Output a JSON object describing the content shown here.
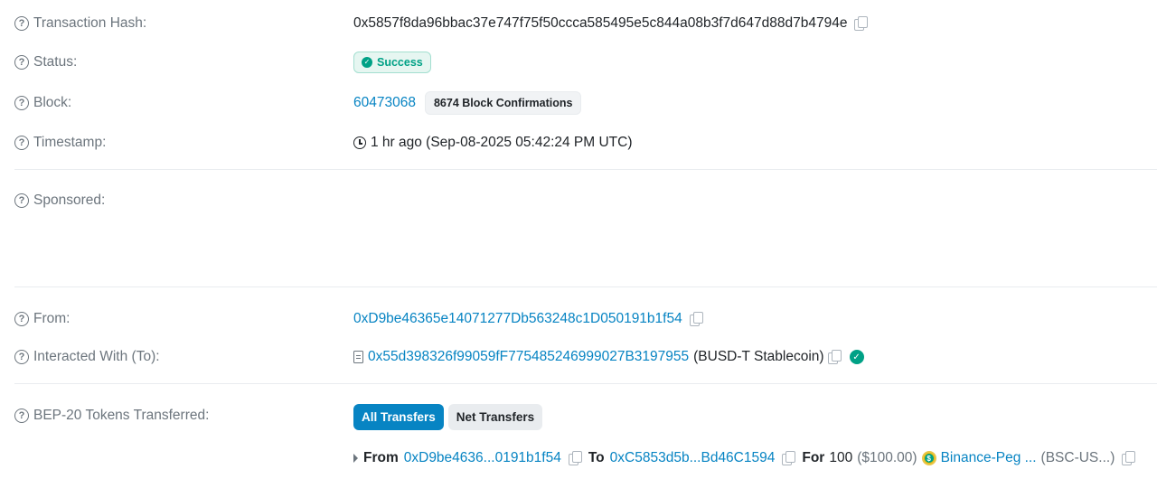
{
  "tx_hash": {
    "label": "Transaction Hash:",
    "value": "0x5857f8da96bbac37e747f75f50ccca585495e5c844a08b3f7d647d88d7b4794e"
  },
  "status": {
    "label": "Status:",
    "value": "Success"
  },
  "block": {
    "label": "Block:",
    "number": "60473068",
    "confirmations": "8674 Block Confirmations"
  },
  "timestamp": {
    "label": "Timestamp:",
    "value": "1 hr ago (Sep-08-2025 05:42:24 PM UTC)"
  },
  "sponsored": {
    "label": "Sponsored:"
  },
  "from": {
    "label": "From:",
    "address": "0xD9be46365e14071277Db563248c1D050191b1f54"
  },
  "interacted": {
    "label": "Interacted With (To):",
    "address": "0x55d398326f99059fF775485246999027B3197955",
    "name": "(BUSD-T Stablecoin)"
  },
  "tokens": {
    "label": "BEP-20 Tokens Transferred:",
    "tabs": [
      "All Transfers",
      "Net Transfers"
    ],
    "transfer": {
      "from_label": "From",
      "from_address": "0xD9be4636...0191b1f54",
      "to_label": "To",
      "to_address": "0xC5853d5b...Bd46C1594",
      "for_label": "For",
      "amount": "100",
      "usd": "($100.00)",
      "token_name": "Binance-Peg ...",
      "token_symbol": "(BSC-US...)"
    }
  },
  "colors": {
    "link": "#0784c3",
    "success": "#00a186",
    "muted": "#6c757d"
  }
}
